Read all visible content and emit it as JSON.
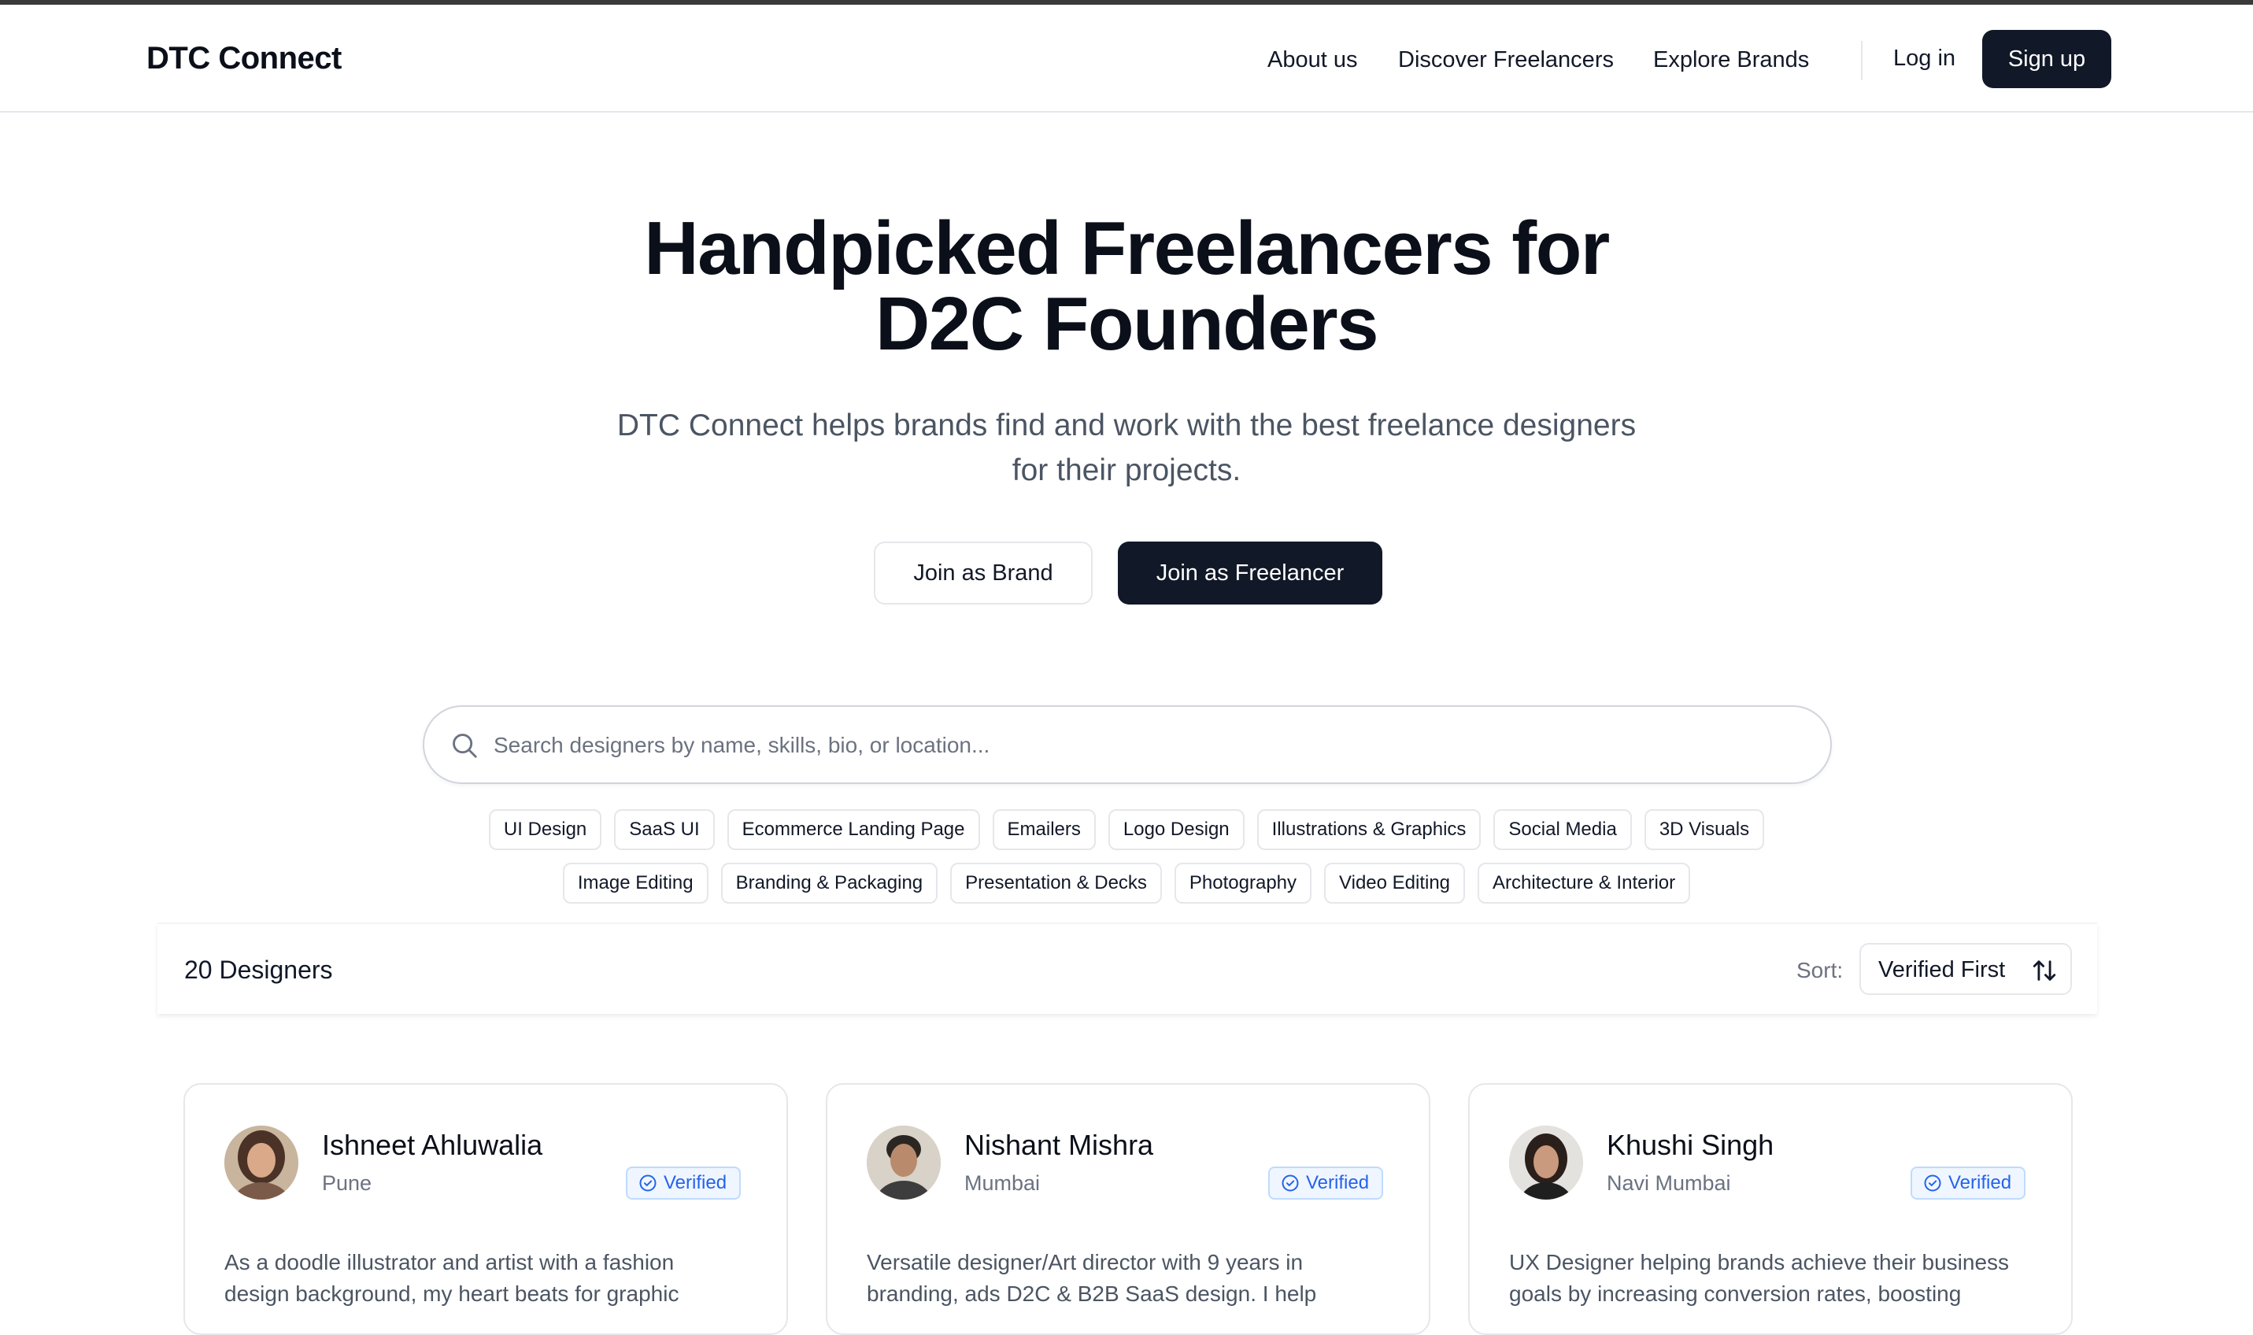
{
  "header": {
    "logo": "DTC Connect",
    "nav": [
      "About us",
      "Discover Freelancers",
      "Explore Brands"
    ],
    "login": "Log in",
    "signup": "Sign up"
  },
  "hero": {
    "title_line1": "Handpicked Freelancers for",
    "title_line2": "D2C Founders",
    "subtitle_line1": "DTC Connect helps brands find and work with the best freelance designers",
    "subtitle_line2": "for their projects.",
    "join_brand": "Join as Brand",
    "join_freelancer": "Join as Freelancer"
  },
  "search": {
    "placeholder": "Search designers by name, skills, bio, or location..."
  },
  "tags_row1": [
    "UI Design",
    "SaaS UI",
    "Ecommerce Landing Page",
    "Emailers",
    "Logo Design",
    "Illustrations & Graphics",
    "Social Media",
    "3D Visuals"
  ],
  "tags_row2": [
    "Image Editing",
    "Branding & Packaging",
    "Presentation & Decks",
    "Photography",
    "Video Editing",
    "Architecture & Interior"
  ],
  "results": {
    "count": "20 Designers",
    "sort_label": "Sort:",
    "sort_value": "Verified First"
  },
  "designers": [
    {
      "name": "Ishneet Ahluwalia",
      "location": "Pune",
      "badge": "Verified",
      "bio": "As a doodle illustrator and artist with a fashion design background, my heart beats for graphic"
    },
    {
      "name": "Nishant Mishra",
      "location": "Mumbai",
      "badge": "Verified",
      "bio": "Versatile designer/Art director with 9 years in branding, ads D2C & B2B SaaS design. I help"
    },
    {
      "name": "Khushi Singh",
      "location": "Navi Mumbai",
      "badge": "Verified",
      "bio": "UX Designer helping brands achieve their business goals by increasing conversion rates, boosting"
    }
  ],
  "colors": {
    "primary_dark": "#111827",
    "verified_blue": "#2563eb",
    "muted_text": "#6b7280"
  }
}
